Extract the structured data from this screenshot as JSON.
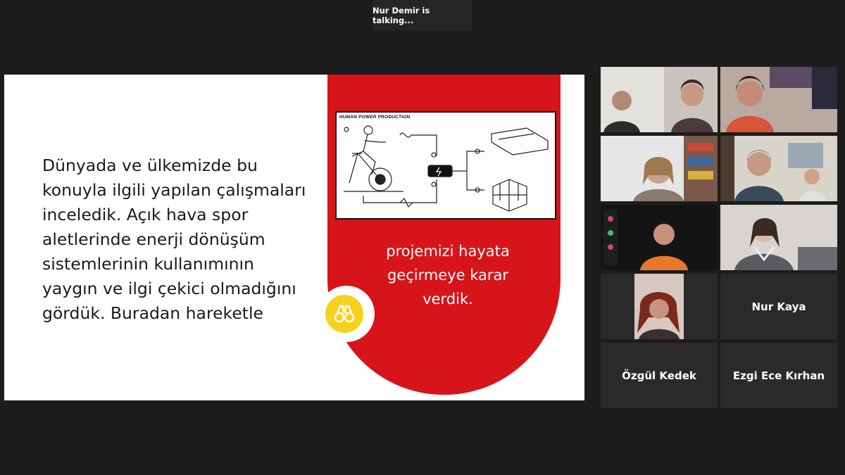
{
  "speaker_banner": {
    "text": "Nur Demir is talking..."
  },
  "slide": {
    "body_text": "Dünyada ve ülkemizde bu\nkonuyla ilgili yapılan çalışmaları\ninceledik. Açık hava spor\naletlerinde enerji dönüşüm\nsistemlerinin kullanımının\nyaygın ve ilgi çekici olmadığını\ngördük. Buradan hareketle",
    "diagram_title": "HUMAN POWER PRODUCTION",
    "red_text": "projemizi hayata geçirmeye karar verdik.",
    "accent_red": "#d7141a",
    "accent_yellow": "#f5d21d"
  },
  "participants": [
    {
      "name": "",
      "video": true
    },
    {
      "name": "",
      "video": true
    },
    {
      "name": "",
      "video": true
    },
    {
      "name": "",
      "video": true
    },
    {
      "name": "",
      "video": true
    },
    {
      "name": "",
      "video": true
    },
    {
      "name": "",
      "video": true
    },
    {
      "name": "Nur Kaya",
      "video": false
    },
    {
      "name": "Özgül Kedek",
      "video": false
    },
    {
      "name": "Ezgi Ece Kırhan",
      "video": false
    }
  ]
}
